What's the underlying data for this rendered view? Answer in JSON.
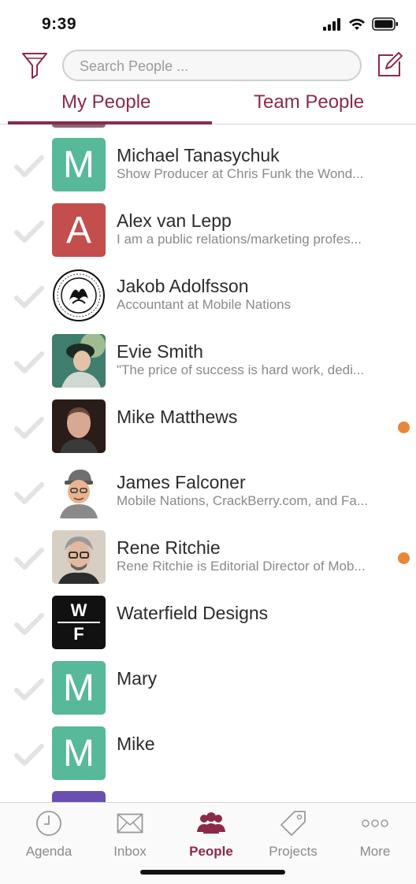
{
  "status_bar": {
    "time": "9:39"
  },
  "header": {
    "search_placeholder": "Search People ..."
  },
  "tabs": [
    {
      "label": "My People",
      "active": true
    },
    {
      "label": "Team People",
      "active": false
    }
  ],
  "people": [
    {
      "name": "Michael Tanasychuk",
      "subtitle": "Show Producer at Chris Funk the Wond...",
      "avatar_letter": "M",
      "avatar_color": "#57b89a",
      "unread": false
    },
    {
      "name": "Alex van Lepp",
      "subtitle": "I am a public relations/marketing profes...",
      "avatar_letter": "A",
      "avatar_color": "#c44d4d",
      "unread": false
    },
    {
      "name": "Jakob Adolfsson",
      "subtitle": "Accountant at Mobile Nations",
      "avatar_icon": "university-seal-icon",
      "unread": false
    },
    {
      "name": "Evie Smith",
      "subtitle": "\"The price of success is hard work, dedi...",
      "avatar_icon": "photo-portrait-icon",
      "unread": false
    },
    {
      "name": "Mike Matthews",
      "subtitle": "",
      "avatar_icon": "photo-portrait-icon",
      "unread": true
    },
    {
      "name": "James Falconer",
      "subtitle": "Mobile Nations, CrackBerry.com, and Fa...",
      "avatar_icon": "cartoon-portrait-icon",
      "unread": false
    },
    {
      "name": "Rene Ritchie",
      "subtitle": "Rene Ritchie is Editorial Director of Mob...",
      "avatar_icon": "photo-portrait-icon",
      "unread": true
    },
    {
      "name": "Waterfield Designs",
      "subtitle": "",
      "avatar_logo_top": "W",
      "avatar_logo_bottom": "F",
      "avatar_color": "#111111",
      "unread": false
    },
    {
      "name": "Mary",
      "subtitle": "",
      "avatar_letter": "M",
      "avatar_color": "#57b89a",
      "unread": false
    },
    {
      "name": "Mike",
      "subtitle": "",
      "avatar_letter": "M",
      "avatar_color": "#57b89a",
      "unread": false
    }
  ],
  "bottom_nav": [
    {
      "label": "Agenda",
      "icon": "clock-icon",
      "active": false
    },
    {
      "label": "Inbox",
      "icon": "envelope-icon",
      "active": false
    },
    {
      "label": "People",
      "icon": "people-icon",
      "active": true
    },
    {
      "label": "Projects",
      "icon": "tag-icon",
      "active": false
    },
    {
      "label": "More",
      "icon": "more-dots-icon",
      "active": false
    }
  ],
  "colors": {
    "accent": "#8b2a48",
    "unread_dot": "#e8873a",
    "check": "#e3e3e3"
  }
}
